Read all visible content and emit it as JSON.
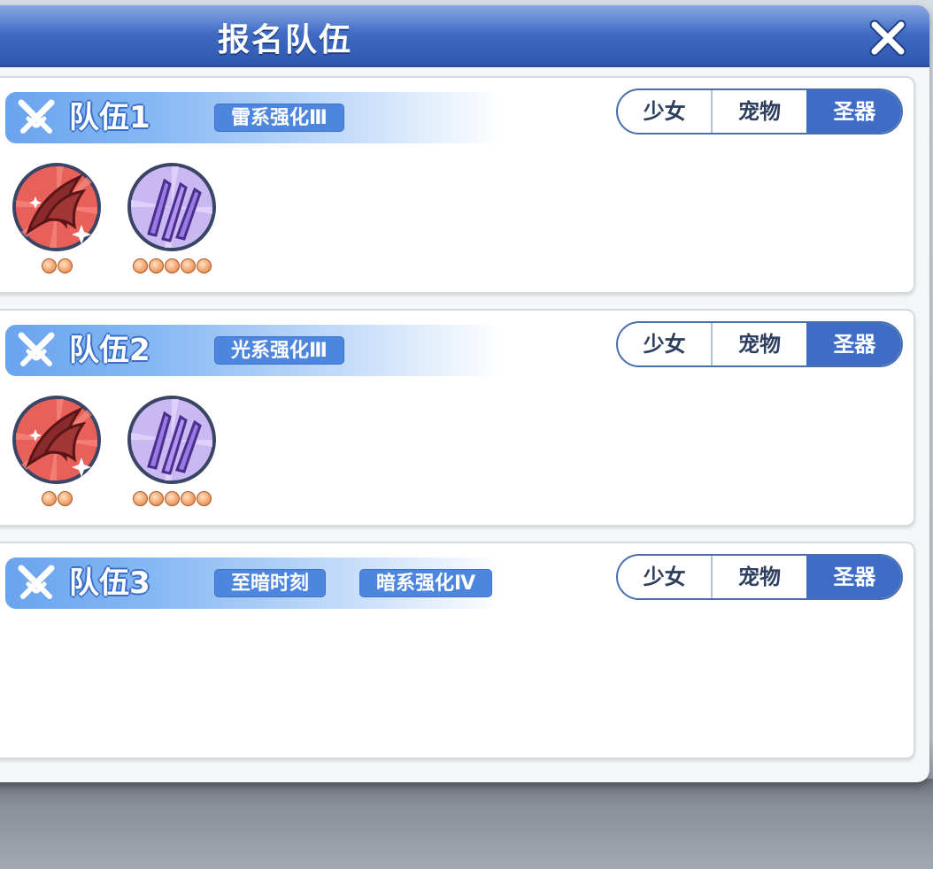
{
  "window": {
    "title": "报名队伍"
  },
  "teams": [
    {
      "name": "队伍1",
      "tags": [
        "雷系强化Ⅲ"
      ],
      "tabs": [
        "少女",
        "宠物",
        "圣器"
      ],
      "active_tab": "圣器",
      "relics": [
        {
          "icon": "red-claw-relic-icon",
          "stars": 2
        },
        {
          "icon": "purple-blades-relic-icon",
          "stars": 5
        }
      ]
    },
    {
      "name": "队伍2",
      "tags": [
        "光系强化Ⅲ"
      ],
      "tabs": [
        "少女",
        "宠物",
        "圣器"
      ],
      "active_tab": "圣器",
      "relics": [
        {
          "icon": "red-claw-relic-icon",
          "stars": 2
        },
        {
          "icon": "purple-blades-relic-icon",
          "stars": 5
        }
      ]
    },
    {
      "name": "队伍3",
      "tags": [
        "至暗时刻",
        "暗系强化Ⅳ"
      ],
      "tabs": [
        "少女",
        "宠物",
        "圣器"
      ],
      "active_tab": "圣器",
      "relics": []
    }
  ],
  "colors": {
    "titlebar": "#3d68c0",
    "tag": "#4e86de",
    "active_tab": "#3f6cc4"
  }
}
